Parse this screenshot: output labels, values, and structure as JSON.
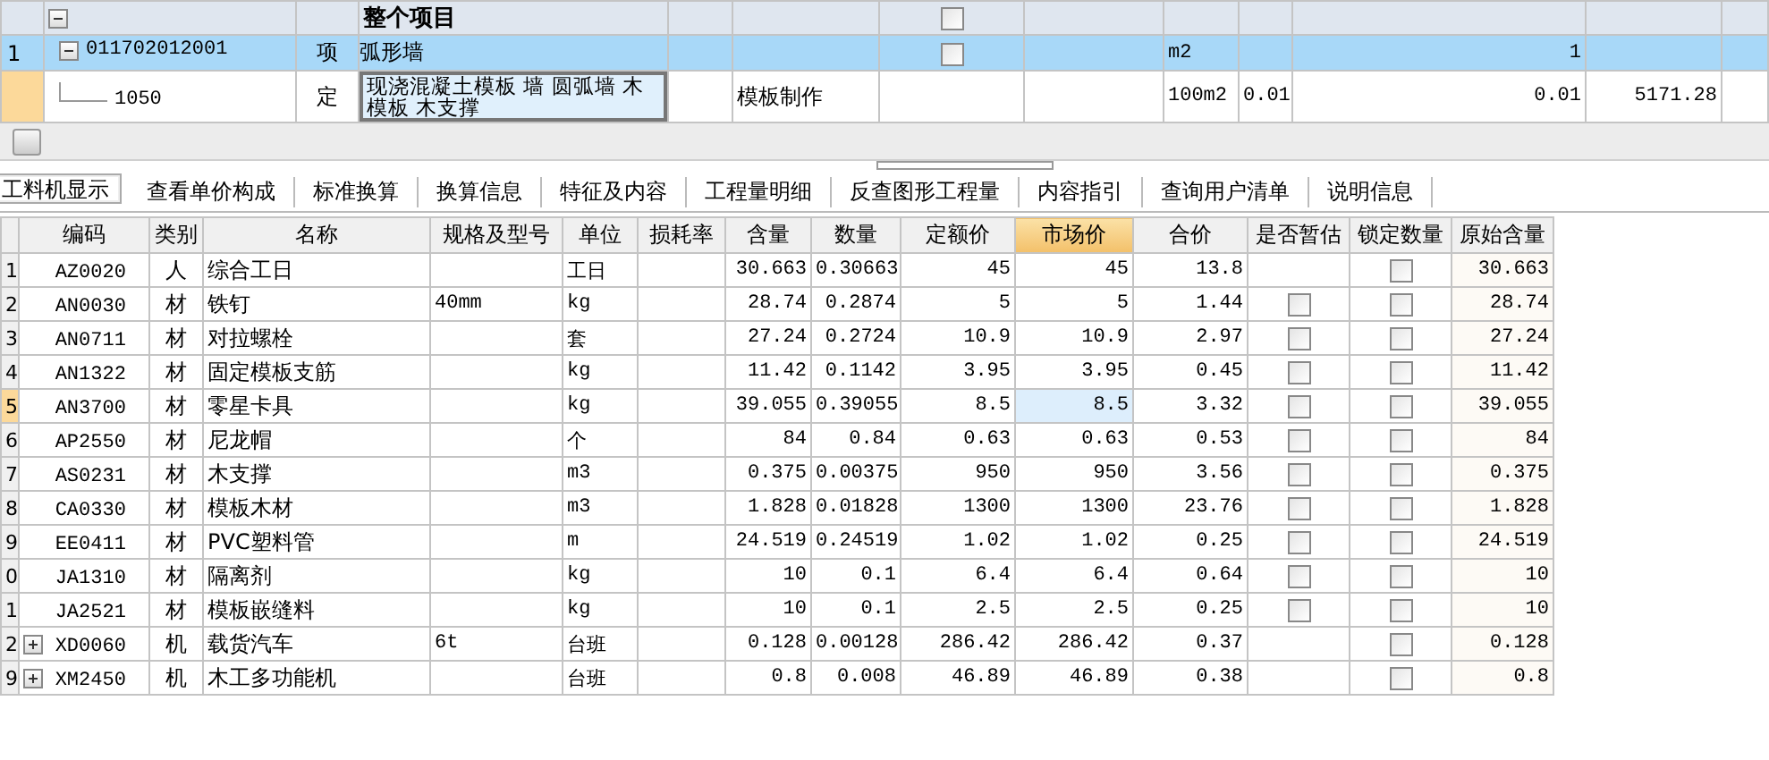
{
  "top_grid": {
    "header_row": {
      "expanded": true,
      "title": "整个项目",
      "checked": false
    },
    "rows": [
      {
        "number": "1",
        "code": "011702012001",
        "expanded": true,
        "type": "项",
        "name": "弧形墙",
        "content": "",
        "checked": false,
        "unit": "m2",
        "col_9": "",
        "quantity": "1",
        "price": "",
        "selected": true,
        "editing": false
      },
      {
        "number": "",
        "code": "1050",
        "expanded": null,
        "type": "定",
        "name": "现浇混凝土模板 墙 圆弧墙 木模板 木支撑",
        "content": "模板制作",
        "checked": null,
        "unit": "100m2",
        "col_9": "0.01",
        "quantity": "0.01",
        "price": "5171.28",
        "selected": false,
        "editing": true
      }
    ]
  },
  "tabs": [
    {
      "label": "工料机显示",
      "selected": true
    },
    {
      "label": "查看单价构成",
      "selected": false
    },
    {
      "label": "标准换算",
      "selected": false
    },
    {
      "label": "换算信息",
      "selected": false
    },
    {
      "label": "特征及内容",
      "selected": false
    },
    {
      "label": "工程量明细",
      "selected": false
    },
    {
      "label": "反查图形工程量",
      "selected": false
    },
    {
      "label": "内容指引",
      "selected": false
    },
    {
      "label": "查询用户清单",
      "selected": false
    },
    {
      "label": "说明信息",
      "selected": false
    }
  ],
  "table": {
    "columns": [
      {
        "label": "编码",
        "selected": false
      },
      {
        "label": "类别",
        "selected": false
      },
      {
        "label": "名称",
        "selected": false
      },
      {
        "label": "规格及型号",
        "selected": false
      },
      {
        "label": "单位",
        "selected": false
      },
      {
        "label": "损耗率",
        "selected": false
      },
      {
        "label": "含量",
        "selected": false
      },
      {
        "label": "数量",
        "selected": false
      },
      {
        "label": "定额价",
        "selected": false
      },
      {
        "label": "市场价",
        "selected": true
      },
      {
        "label": "合价",
        "selected": false
      },
      {
        "label": "是否暂估",
        "selected": false
      },
      {
        "label": "锁定数量",
        "selected": false
      },
      {
        "label": "原始含量",
        "selected": false
      }
    ],
    "rows": [
      {
        "number": "1",
        "expanded": null,
        "code": "AZ0020",
        "category": "人",
        "name": "综合工日",
        "spec": "",
        "unit": "工日",
        "loss": "",
        "content": "30.663",
        "qty": "0.30663",
        "quota_price": "45",
        "market_price": "45",
        "total": "13.8",
        "provisional": null,
        "locked": false,
        "original": "30.663",
        "selected": false
      },
      {
        "number": "2",
        "expanded": null,
        "code": "AN0030",
        "category": "材",
        "name": "铁钉",
        "spec": "40mm",
        "unit": "kg",
        "loss": "",
        "content": "28.74",
        "qty": "0.2874",
        "quota_price": "5",
        "market_price": "5",
        "total": "1.44",
        "provisional": false,
        "locked": false,
        "original": "28.74",
        "selected": false
      },
      {
        "number": "3",
        "expanded": null,
        "code": "AN0711",
        "category": "材",
        "name": "对拉螺栓",
        "spec": "",
        "unit": "套",
        "loss": "",
        "content": "27.24",
        "qty": "0.2724",
        "quota_price": "10.9",
        "market_price": "10.9",
        "total": "2.97",
        "provisional": false,
        "locked": false,
        "original": "27.24",
        "selected": false
      },
      {
        "number": "4",
        "expanded": null,
        "code": "AN1322",
        "category": "材",
        "name": "固定模板支筋",
        "spec": "",
        "unit": "kg",
        "loss": "",
        "content": "11.42",
        "qty": "0.1142",
        "quota_price": "3.95",
        "market_price": "3.95",
        "total": "0.45",
        "provisional": false,
        "locked": false,
        "original": "11.42",
        "selected": false
      },
      {
        "number": "5",
        "expanded": null,
        "code": "AN3700",
        "category": "材",
        "name": "零星卡具",
        "spec": "",
        "unit": "kg",
        "loss": "",
        "content": "39.055",
        "qty": "0.39055",
        "quota_price": "8.5",
        "market_price": "8.5",
        "total": "3.32",
        "provisional": false,
        "locked": false,
        "original": "39.055",
        "selected": true
      },
      {
        "number": "6",
        "expanded": null,
        "code": "AP2550",
        "category": "材",
        "name": "尼龙帽",
        "spec": "",
        "unit": "个",
        "loss": "",
        "content": "84",
        "qty": "0.84",
        "quota_price": "0.63",
        "market_price": "0.63",
        "total": "0.53",
        "provisional": false,
        "locked": false,
        "original": "84",
        "selected": false
      },
      {
        "number": "7",
        "expanded": null,
        "code": "AS0231",
        "category": "材",
        "name": "木支撑",
        "spec": "",
        "unit": "m3",
        "loss": "",
        "content": "0.375",
        "qty": "0.00375",
        "quota_price": "950",
        "market_price": "950",
        "total": "3.56",
        "provisional": false,
        "locked": false,
        "original": "0.375",
        "selected": false
      },
      {
        "number": "8",
        "expanded": null,
        "code": "CA0330",
        "category": "材",
        "name": "模板木材",
        "spec": "",
        "unit": "m3",
        "loss": "",
        "content": "1.828",
        "qty": "0.01828",
        "quota_price": "1300",
        "market_price": "1300",
        "total": "23.76",
        "provisional": false,
        "locked": false,
        "original": "1.828",
        "selected": false
      },
      {
        "number": "9",
        "expanded": null,
        "code": "EE0411",
        "category": "材",
        "name": "PVC塑料管",
        "spec": "",
        "unit": "m",
        "loss": "",
        "content": "24.519",
        "qty": "0.24519",
        "quota_price": "1.02",
        "market_price": "1.02",
        "total": "0.25",
        "provisional": false,
        "locked": false,
        "original": "24.519",
        "selected": false
      },
      {
        "number": "0",
        "expanded": null,
        "code": "JA1310",
        "category": "材",
        "name": "隔离剂",
        "spec": "",
        "unit": "kg",
        "loss": "",
        "content": "10",
        "qty": "0.1",
        "quota_price": "6.4",
        "market_price": "6.4",
        "total": "0.64",
        "provisional": false,
        "locked": false,
        "original": "10",
        "selected": false
      },
      {
        "number": "1",
        "expanded": null,
        "code": "JA2521",
        "category": "材",
        "name": "模板嵌缝料",
        "spec": "",
        "unit": "kg",
        "loss": "",
        "content": "10",
        "qty": "0.1",
        "quota_price": "2.5",
        "market_price": "2.5",
        "total": "0.25",
        "provisional": false,
        "locked": false,
        "original": "10",
        "selected": false
      },
      {
        "number": "2",
        "expanded": false,
        "code": "XD0060",
        "category": "机",
        "name": "载货汽车",
        "spec": "6t",
        "unit": "台班",
        "loss": "",
        "content": "0.128",
        "qty": "0.00128",
        "quota_price": "286.42",
        "market_price": "286.42",
        "total": "0.37",
        "provisional": null,
        "locked": false,
        "original": "0.128",
        "selected": false
      },
      {
        "number": "9",
        "expanded": false,
        "code": "XM2450",
        "category": "机",
        "name": "木工多功能机",
        "spec": "",
        "unit": "台班",
        "loss": "",
        "content": "0.8",
        "qty": "0.008",
        "quota_price": "46.89",
        "market_price": "46.89",
        "total": "0.38",
        "provisional": null,
        "locked": false,
        "original": "0.8",
        "selected": false
      }
    ]
  }
}
